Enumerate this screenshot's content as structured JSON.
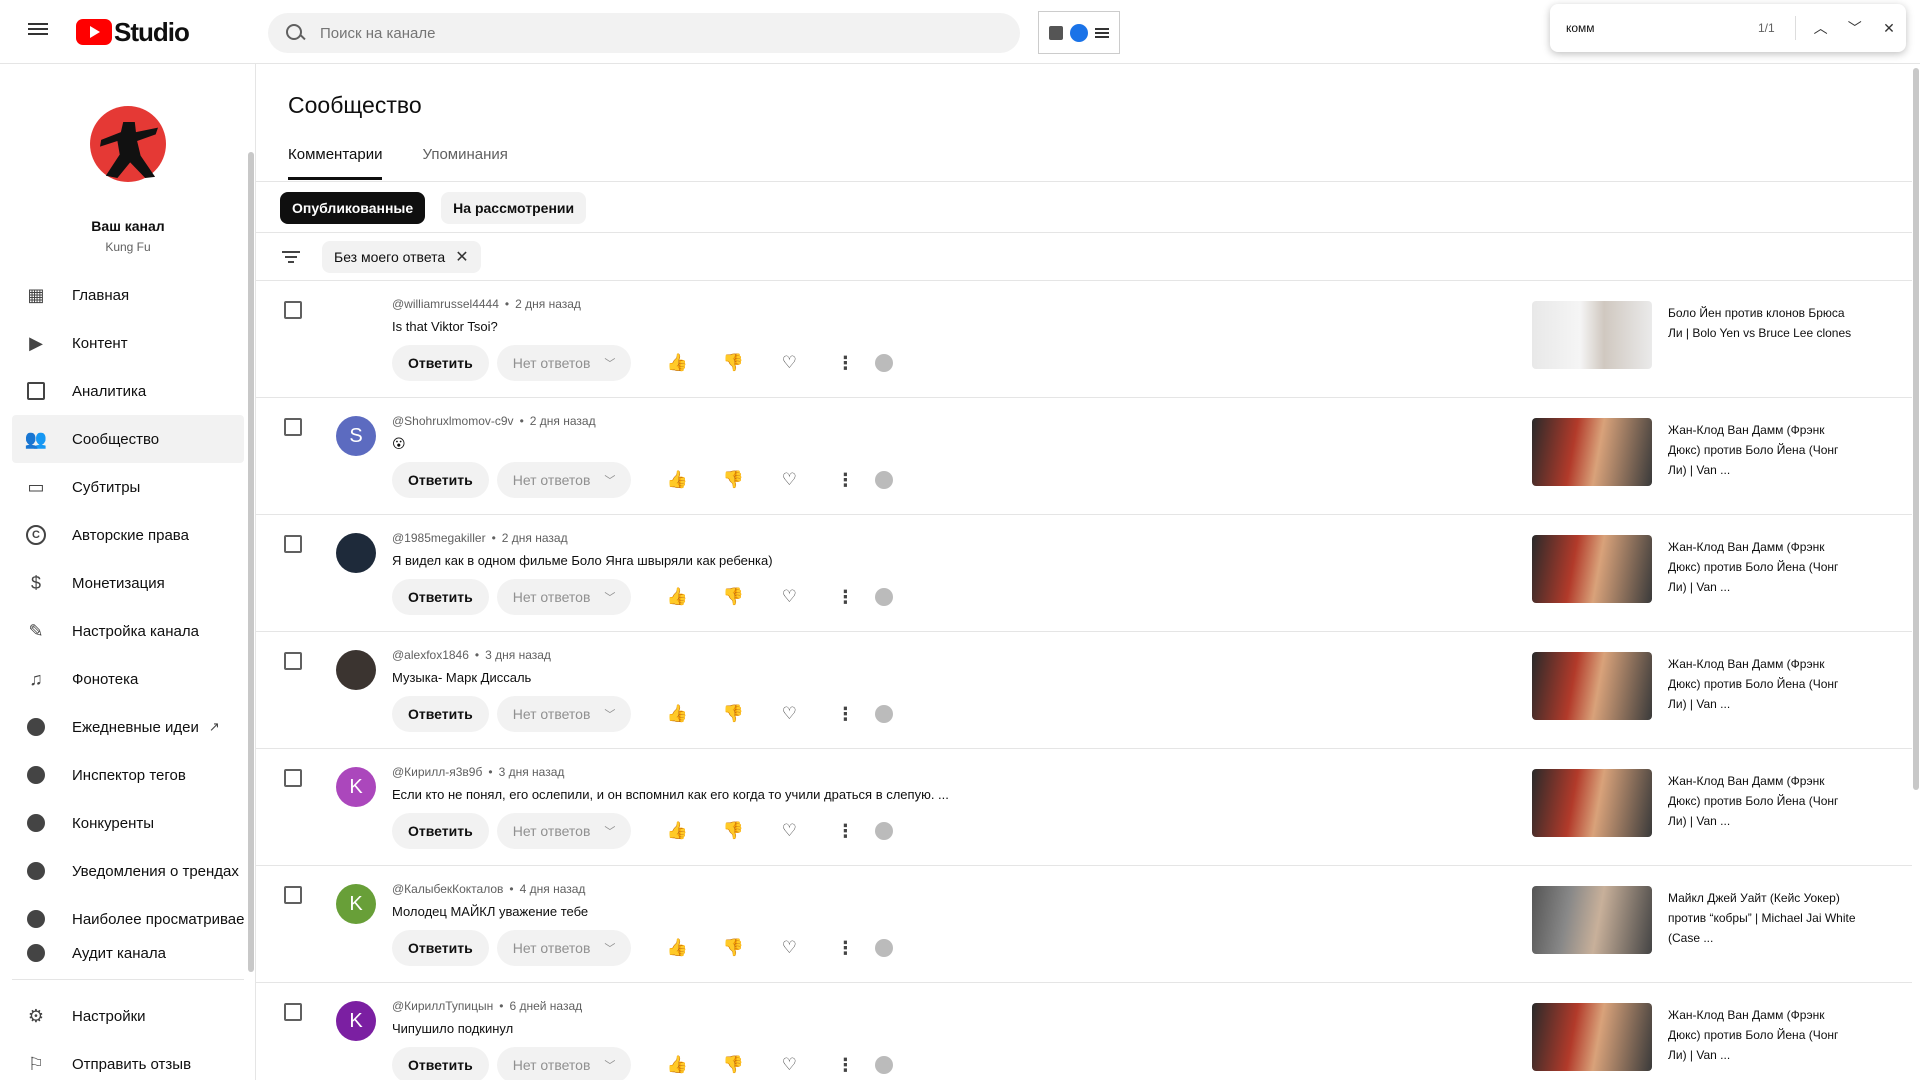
{
  "header": {
    "logo_text": "Studio",
    "search_placeholder": "Поиск на канале"
  },
  "findbar": {
    "query": "комм",
    "count": "1/1"
  },
  "channel": {
    "title": "Ваш канал",
    "subtitle": "Kung Fu"
  },
  "sidebar": {
    "items": [
      {
        "label": "Главная",
        "icon": "dashboard-icon"
      },
      {
        "label": "Контент",
        "icon": "content-icon"
      },
      {
        "label": "Аналитика",
        "icon": "analytics-icon"
      },
      {
        "label": "Сообщество",
        "icon": "community-icon"
      },
      {
        "label": "Субтитры",
        "icon": "subtitles-icon"
      },
      {
        "label": "Авторские права",
        "icon": "copyright-icon"
      },
      {
        "label": "Монетизация",
        "icon": "dollar-icon"
      },
      {
        "label": "Настройка канала",
        "icon": "magic-wand-icon"
      },
      {
        "label": "Фонотека",
        "icon": "audio-library-icon"
      },
      {
        "label": "Ежедневные идеи",
        "icon": "extension-icon"
      },
      {
        "label": "Инспектор тегов",
        "icon": "extension-icon"
      },
      {
        "label": "Конкуренты",
        "icon": "extension-icon"
      },
      {
        "label": "Уведомления о трендах",
        "icon": "extension-icon"
      },
      {
        "label": "Наиболее просматривае",
        "icon": "extension-icon"
      },
      {
        "label": "Аудит канала",
        "icon": "extension-icon"
      }
    ],
    "bottom": [
      {
        "label": "Настройки",
        "icon": "gear-icon"
      },
      {
        "label": "Отправить отзыв",
        "icon": "feedback-icon"
      }
    ]
  },
  "page": {
    "title": "Сообщество",
    "tabs": [
      "Комментарии",
      "Упоминания"
    ],
    "chips": [
      "Опубликованные",
      "На рассмотрении"
    ],
    "filter_chip": "Без моего ответа"
  },
  "actions": {
    "reply": "Ответить",
    "no_replies": "Нет ответов"
  },
  "comments": [
    {
      "author": "@williamrussel4444",
      "time": "2 дня назад",
      "text": "Is that Viktor Tsoi?",
      "avatar_letter": "",
      "avatar_color": "#ffffff",
      "video": "Боло Йен против клонов Брюса Ли | Bolo Yen vs Bruce Lee clones"
    },
    {
      "author": "@Shohruxlmomov-c9v",
      "time": "2 дня назад",
      "text": "😮",
      "avatar_letter": "S",
      "avatar_color": "#5c6bc0",
      "video": "Жан-Клод Ван Дамм (Фрэнк Дюкс) против Боло Йена (Чонг Ли) | Van ..."
    },
    {
      "author": "@1985megakiller",
      "time": "2 дня назад",
      "text": "Я видел как в одном фильме Боло Янга швыряли как ребенка)",
      "avatar_letter": "",
      "avatar_color": "#1e2a3a",
      "video": "Жан-Клод Ван Дамм (Фрэнк Дюкс) против Боло Йена (Чонг Ли) | Van ..."
    },
    {
      "author": "@alexfox1846",
      "time": "3 дня назад",
      "text": "Музыка- Марк Диссаль",
      "avatar_letter": "",
      "avatar_color": "#3b3430",
      "video": "Жан-Клод Ван Дамм (Фрэнк Дюкс) против Боло Йена (Чонг Ли) | Van ..."
    },
    {
      "author": "@Кирилл-я3в9б",
      "time": "3 дня назад",
      "text": "Если кто не понял, его ослепили, и он вспомнил как его когда то учили драться в слепую. ...",
      "avatar_letter": "K",
      "avatar_color": "#ab47bc",
      "video": "Жан-Клод Ван Дамм (Фрэнк Дюкс) против Боло Йена (Чонг Ли) | Van ..."
    },
    {
      "author": "@КалыбекКокталов",
      "time": "4 дня назад",
      "text": "Молодец МАЙКЛ уважение  тебе",
      "avatar_letter": "K",
      "avatar_color": "#689f38",
      "video": "Майкл Джей Уайт (Кейс Уокер) против “кобры” | Michael Jai White (Case ..."
    },
    {
      "author": "@КириллТупицын",
      "time": "6 дней назад",
      "text": "Чипушило подкинул",
      "avatar_letter": "K",
      "avatar_color": "#7b1fa2",
      "video": "Жан-Клод Ван Дамм (Фрэнк Дюкс) против Боло Йена (Чонг Ли) | Van ..."
    }
  ]
}
